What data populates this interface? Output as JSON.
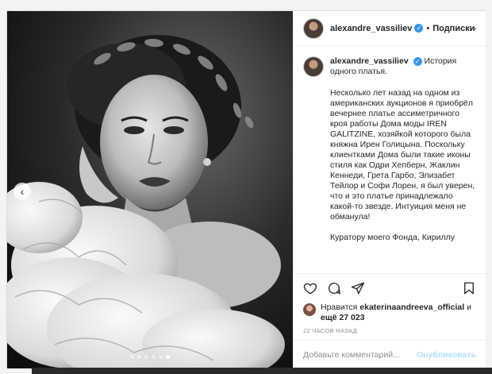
{
  "post": {
    "author": "alexandre_vassiliev",
    "separator": "•",
    "follow_label": "Подписки",
    "more_label": "···",
    "caption": {
      "intro": "История одного платья.",
      "body": "Несколько лет назад на одном из американских аукционов я приобрёл вечернее платье ассиметричного кроя работы Дома моды IREN GALITZINE, хозяйкой которого была княжна Ирен Голицына. Поскольку клиентками Дома были такие иконы стиля как Одри Хепберн, Жаклин Кеннеди, Грета Гарбо, Элизабет Тейлор и Софи Лорен, я был уверен, что и это платье принадлежало какой-то звезде. Интуиция меня не обманула!\n\nКуратору моего Фонда, Кириллу"
    },
    "likes": {
      "prefix": "Нравится",
      "liker": "ekaterinaandreeva_official",
      "and": "и",
      "others": "ещё 27 023"
    },
    "timestamp": "22 ЧАСОВ НАЗАД",
    "comment": {
      "placeholder": "Добавьте комментарий...",
      "publish_label": "Опубликовать"
    },
    "carousel": {
      "prev_label": "‹",
      "slides": 6,
      "active": 6
    }
  },
  "icons": [
    "heart-icon",
    "comment-icon",
    "share-icon",
    "bookmark-icon",
    "verified-icon",
    "chevron-left-icon"
  ],
  "colors": {
    "verified": "#3897f0",
    "publish": "#b2dffc",
    "muted": "#8e8e8e"
  }
}
